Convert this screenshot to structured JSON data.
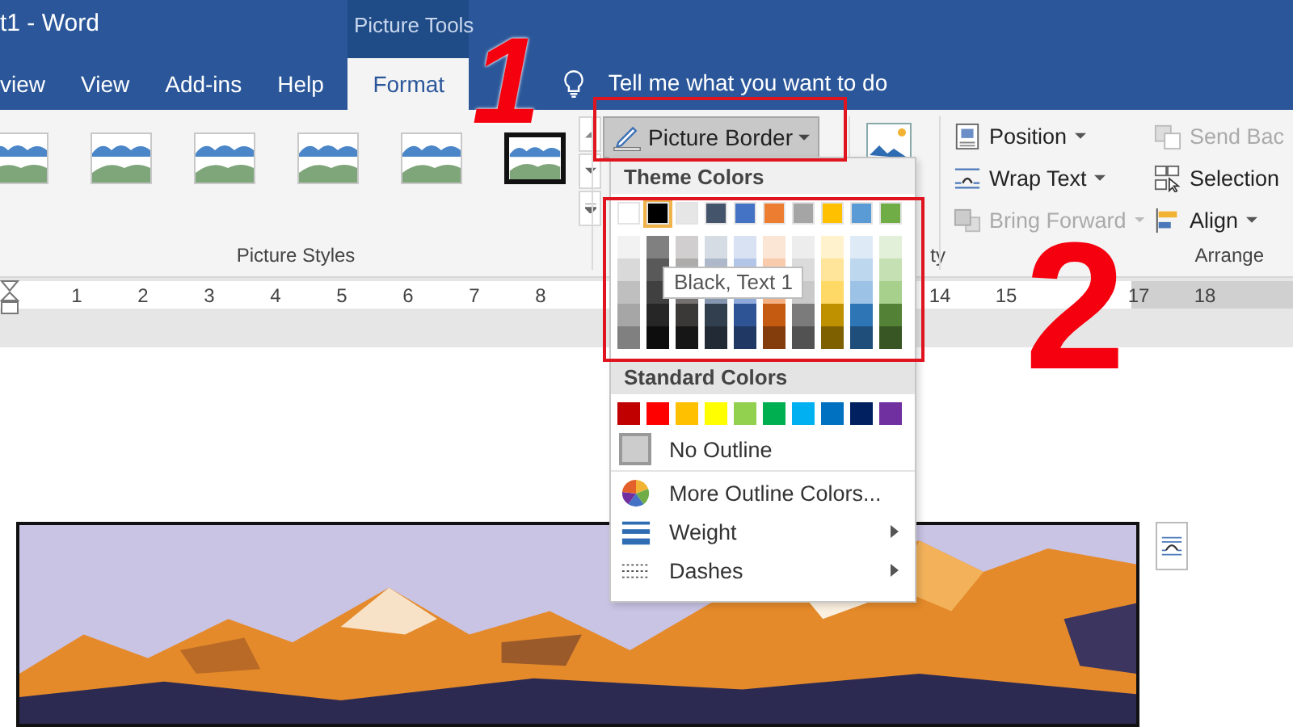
{
  "window": {
    "title": "t1  -  Word",
    "context_header": "Picture Tools"
  },
  "tabs": [
    {
      "label": "view",
      "selected": false
    },
    {
      "label": "View",
      "selected": false
    },
    {
      "label": "Add-ins",
      "selected": false
    },
    {
      "label": "Help",
      "selected": false
    },
    {
      "label": "Format",
      "selected": true
    }
  ],
  "tell_me": {
    "placeholder": "Tell me what you want to do"
  },
  "ribbon": {
    "picture_styles": {
      "label": "Picture Styles",
      "styles": [
        {
          "framed": false
        },
        {
          "framed": false
        },
        {
          "framed": false
        },
        {
          "framed": false
        },
        {
          "framed": false
        },
        {
          "framed": true
        }
      ]
    },
    "picture_border": {
      "label": "Picture Border",
      "pressed": true
    },
    "partial_group_label": "ty",
    "arrange": {
      "label": "Arrange",
      "commands": [
        {
          "kind": "position",
          "label": "Position",
          "caret": true,
          "disabled": false
        },
        {
          "kind": "send-backward",
          "label": "Send Bac",
          "caret": false,
          "disabled": true
        },
        {
          "kind": "wrap",
          "label": "Wrap Text",
          "caret": true,
          "disabled": false
        },
        {
          "kind": "selection",
          "label": "Selection",
          "caret": false,
          "disabled": false
        },
        {
          "kind": "bring-forward",
          "label": "Bring Forward",
          "caret": true,
          "disabled": true
        },
        {
          "kind": "align",
          "label": "Align",
          "caret": true,
          "disabled": false
        }
      ]
    }
  },
  "ruler": {
    "left_numbers": [
      "1",
      "2",
      "3",
      "4",
      "5",
      "6",
      "7",
      "8"
    ],
    "right_numbers": [
      "14",
      "15",
      "17",
      "18"
    ]
  },
  "picture_border_menu": {
    "theme_header": "Theme Colors",
    "theme_colors": [
      {
        "color": "#ffffff",
        "selected": false,
        "shades": [
          {
            "color": "#f2f2f2"
          },
          {
            "color": "#d9d9d9"
          },
          {
            "color": "#bfbfbf"
          },
          {
            "color": "#a6a6a6"
          },
          {
            "color": "#808080"
          }
        ]
      },
      {
        "color": "#000000",
        "selected": true,
        "shades": [
          {
            "color": "#808080"
          },
          {
            "color": "#595959"
          },
          {
            "color": "#404040"
          },
          {
            "color": "#262626"
          },
          {
            "color": "#0d0d0d"
          }
        ]
      },
      {
        "color": "#e7e6e6",
        "selected": false,
        "shades": [
          {
            "color": "#d0cece"
          },
          {
            "color": "#aeabab"
          },
          {
            "color": "#757171"
          },
          {
            "color": "#3b3838"
          },
          {
            "color": "#171616"
          }
        ]
      },
      {
        "color": "#44546a",
        "selected": false,
        "shades": [
          {
            "color": "#d6dce4"
          },
          {
            "color": "#adb9ca"
          },
          {
            "color": "#8496b0"
          },
          {
            "color": "#323f4f"
          },
          {
            "color": "#222a35"
          }
        ]
      },
      {
        "color": "#4472c4",
        "selected": false,
        "shades": [
          {
            "color": "#d9e2f3"
          },
          {
            "color": "#b4c6e7"
          },
          {
            "color": "#8eaadb"
          },
          {
            "color": "#2f5496"
          },
          {
            "color": "#1f3864"
          }
        ]
      },
      {
        "color": "#ed7d31",
        "selected": false,
        "shades": [
          {
            "color": "#fbe5d5"
          },
          {
            "color": "#f7cbac"
          },
          {
            "color": "#f4b183"
          },
          {
            "color": "#c55a11"
          },
          {
            "color": "#833c0b"
          }
        ]
      },
      {
        "color": "#a5a5a5",
        "selected": false,
        "shades": [
          {
            "color": "#ededed"
          },
          {
            "color": "#dbdbdb"
          },
          {
            "color": "#c9c9c9"
          },
          {
            "color": "#7b7b7b"
          },
          {
            "color": "#525252"
          }
        ]
      },
      {
        "color": "#ffc000",
        "selected": false,
        "shades": [
          {
            "color": "#fff2cc"
          },
          {
            "color": "#fee599"
          },
          {
            "color": "#ffd965"
          },
          {
            "color": "#bf9000"
          },
          {
            "color": "#7f6000"
          }
        ]
      },
      {
        "color": "#5b9bd5",
        "selected": false,
        "shades": [
          {
            "color": "#deebf6"
          },
          {
            "color": "#bdd7ee"
          },
          {
            "color": "#9cc3e5"
          },
          {
            "color": "#2e75b5"
          },
          {
            "color": "#1e4e79"
          }
        ]
      },
      {
        "color": "#70ad47",
        "selected": false,
        "shades": [
          {
            "color": "#e2efd9"
          },
          {
            "color": "#c5e0b3"
          },
          {
            "color": "#a8d08d"
          },
          {
            "color": "#538135"
          },
          {
            "color": "#375623"
          }
        ]
      }
    ],
    "tooltip": "Black, Text 1",
    "standard_header": "Standard Colors",
    "standard_colors": [
      {
        "color": "#c00000"
      },
      {
        "color": "#ff0000"
      },
      {
        "color": "#ffc000"
      },
      {
        "color": "#ffff00"
      },
      {
        "color": "#92d050"
      },
      {
        "color": "#00b050"
      },
      {
        "color": "#00b0f0"
      },
      {
        "color": "#0070c0"
      },
      {
        "color": "#002060"
      },
      {
        "color": "#7030a0"
      }
    ],
    "items": [
      {
        "kind": "no-outline",
        "label": "No Outline",
        "submenu": false
      },
      {
        "kind": "more-colors",
        "label": "More Outline Colors...",
        "submenu": false
      },
      {
        "kind": "weight",
        "label": "Weight",
        "submenu": true
      },
      {
        "kind": "dashes",
        "label": "Dashes",
        "submenu": true
      }
    ]
  },
  "annotations": {
    "step_numbers": [
      "1",
      "2"
    ]
  }
}
